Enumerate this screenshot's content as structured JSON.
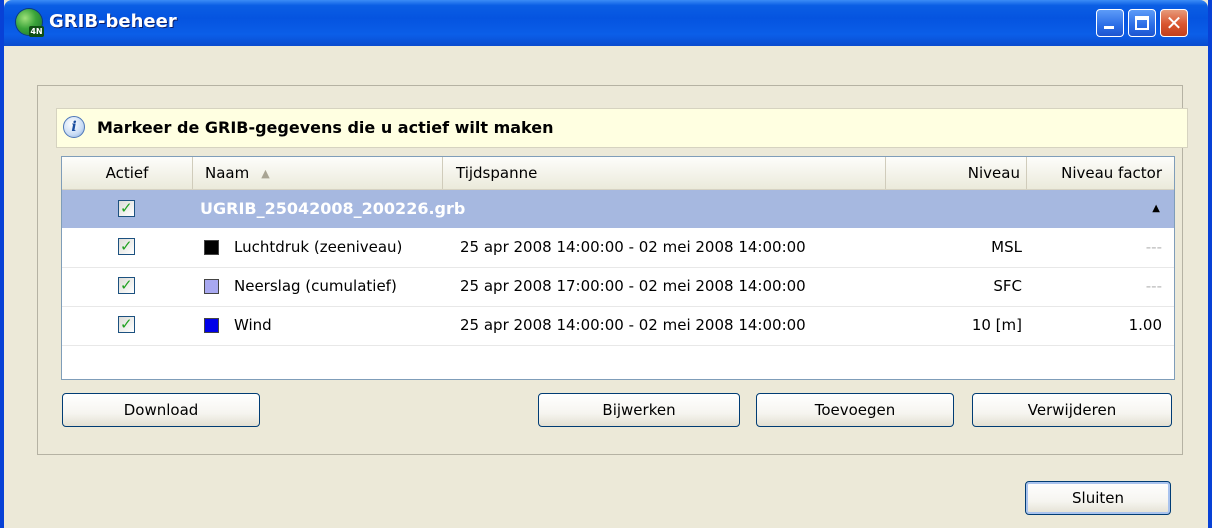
{
  "window": {
    "title": "GRIB-beheer",
    "app_icon_badge": "4N",
    "controls": [
      "minimize-icon",
      "maximize-icon",
      "close-icon"
    ]
  },
  "info": {
    "icon": "info-icon",
    "text": "Markeer de GRIB-gegevens die u actief wilt maken"
  },
  "table": {
    "headers": {
      "actief": "Actief",
      "naam": "Naam",
      "tijdspanne": "Tijdspanne",
      "niveau": "Niveau",
      "niveau_factor": "Niveau factor"
    },
    "sorted_column": "naam",
    "group": {
      "name": "UGRIB_25042008_200226.grb",
      "checked": true,
      "expanded": true
    },
    "rows": [
      {
        "checked": true,
        "color": "#000000",
        "name": "Luchtdruk (zeeniveau)",
        "tijdspanne": "25 apr 2008 14:00:00 - 02 mei 2008 14:00:00",
        "niveau": "MSL",
        "factor": "---"
      },
      {
        "checked": true,
        "color": "#a8a8f0",
        "name": "Neerslag (cumulatief)",
        "tijdspanne": "25 apr 2008 17:00:00 - 02 mei 2008 14:00:00",
        "niveau": "SFC",
        "factor": "---"
      },
      {
        "checked": true,
        "color": "#0000e8",
        "name": "Wind",
        "tijdspanne": "25 apr 2008 14:00:00 - 02 mei 2008 14:00:00",
        "niveau": "10 [m]",
        "factor": "1.00"
      }
    ]
  },
  "buttons": {
    "download": "Download",
    "bijwerken": "Bijwerken",
    "toevoegen": "Toevoegen",
    "verwijderen": "Verwijderen",
    "sluiten": "Sluiten"
  },
  "colors": {
    "titlebar": "#0554e0",
    "group_row": "#a6b8e0",
    "info_background": "#ffffe1",
    "window_background": "#ece9d8"
  }
}
